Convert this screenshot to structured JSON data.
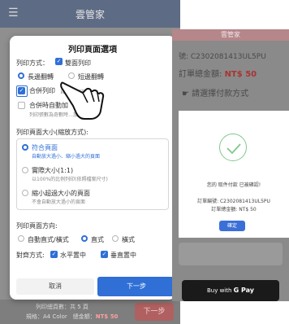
{
  "left_app": {
    "title": "雲管家",
    "bottom": {
      "total_pages": "列印總頁數：共 5 頁",
      "spec_label": "規格：A4 Color　總金額：",
      "amount": "NT$ 50",
      "next": "下一步"
    }
  },
  "dialog": {
    "title": "列印頁面選項",
    "print_mode_label": "列印方式：",
    "duplex_label": "雙面列印",
    "long_edge_label": "長邊翻轉",
    "short_edge_label": "短邊翻轉",
    "combine_label": "合併列印",
    "combine_sub": "自動…列印",
    "auto_combine_label": "合併時自動加",
    "auto_combine_sub": "列印張數為奇數時…加入",
    "page_size_label": "列印頁面大小(縮放方式):",
    "size_options": [
      {
        "label": "符合頁面",
        "sub": "自動放大過小、縮小過大的頁面",
        "selected": true
      },
      {
        "label": "實際大小(1:1)",
        "sub": "以100%的比例列印(依照檔案尺寸)",
        "selected": false
      },
      {
        "label": "縮小超過大小的頁面",
        "sub": "不會自動放大過小的頁面",
        "selected": false
      }
    ],
    "orientation_label": "列印頁面方向:",
    "orientation_options": [
      {
        "label": "自動直式/橫式",
        "selected": false
      },
      {
        "label": "直式",
        "selected": true
      },
      {
        "label": "橫式",
        "selected": false
      }
    ],
    "align_label": "對齊方式:",
    "h_center_label": "水平置中",
    "v_center_label": "垂直置中",
    "cancel": "取消",
    "next": "下一步"
  },
  "right_app": {
    "title": "雲管家",
    "order_no": "號: C2302081413UL5PU",
    "total_label": "訂單總金額: ",
    "total_amount": "NT$ 50",
    "pay_method": "請選擇付款方式",
    "modal": {
      "message": "您的 取件付款 已被確認!",
      "order_line": "訂單編號: C2302081413UL5PU",
      "amount_line": "訂單總金額: NT$ 50",
      "confirm": "確定"
    },
    "gpay_text": "Buy with ",
    "gpay_brand": "G Pay"
  },
  "colors": {
    "accent": "#2f6fd6",
    "left_header": "#5e6b84",
    "right_header": "#b5868a",
    "success": "#7fc98a"
  }
}
